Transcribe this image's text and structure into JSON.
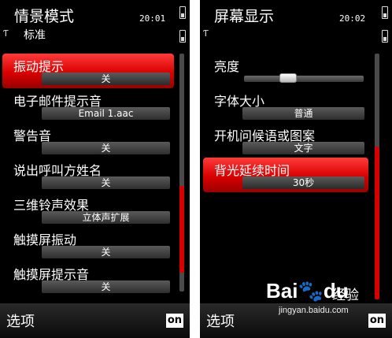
{
  "left_screen": {
    "title": "情景模式",
    "subtitle": "标准",
    "clock": "20:01",
    "items": [
      {
        "label": "振动提示",
        "value": "关",
        "selected": true
      },
      {
        "label": "电子邮件提示音",
        "value": "Email 1.aac",
        "selected": false
      },
      {
        "label": "警告音",
        "value": "关",
        "selected": false
      },
      {
        "label": "说出呼叫方姓名",
        "value": "关",
        "selected": false
      },
      {
        "label": "三维铃声效果",
        "value": "立体声扩展",
        "selected": false
      },
      {
        "label": "触摸屏振动",
        "value": "关",
        "selected": false
      },
      {
        "label": "触摸屏提示音",
        "value": "关",
        "selected": false
      }
    ],
    "softkey_left": "选项",
    "softkey_right_icon": "on"
  },
  "right_screen": {
    "title": "屏幕显示",
    "clock": "20:02",
    "brightness": {
      "label": "亮度",
      "level_percent": 37
    },
    "items": [
      {
        "label": "字体大小",
        "value": "普通",
        "selected": false
      },
      {
        "label": "开机问候语或图案",
        "value": "文字",
        "selected": false
      },
      {
        "label": "背光延续时间",
        "value": "30秒",
        "selected": true
      }
    ],
    "softkey_left": "选项",
    "softkey_right_icon": "on"
  },
  "watermark": {
    "brand": "Bai",
    "brand_tail": "du",
    "chinese": "经验",
    "url": "jingyan.baidu.com"
  },
  "colors": {
    "accent_red": "#d90000",
    "background": "#000000"
  }
}
